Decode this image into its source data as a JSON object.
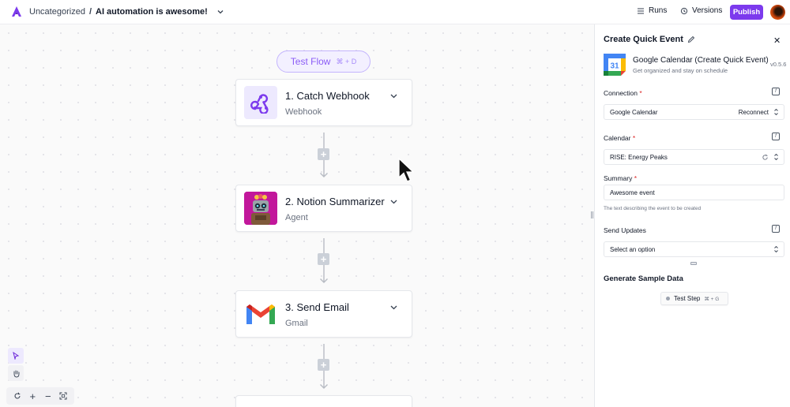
{
  "header": {
    "folder": "Uncategorized",
    "separator": "/",
    "flow_name": "AI automation is awesome!",
    "runs_label": "Runs",
    "versions_label": "Versions",
    "publish_label": "Publish"
  },
  "canvas": {
    "test_flow_label": "Test Flow",
    "test_flow_shortcut": "⌘ + D",
    "steps": [
      {
        "title": "1. Catch Webhook",
        "subtitle": "Webhook",
        "icon": "webhook-icon"
      },
      {
        "title": "2. Notion Summarizer",
        "subtitle": "Agent",
        "icon": "robot-agent-icon"
      },
      {
        "title": "3. Send Email",
        "subtitle": "Gmail",
        "icon": "gmail-icon"
      }
    ],
    "add_button_label": "+"
  },
  "zoom_controls": {
    "plus": "+",
    "minus": "−"
  },
  "panel": {
    "title": "Create Quick Event",
    "piece_name": "Google Calendar (Create Quick Event)",
    "piece_description": "Get organized and stay on schedule",
    "version": "v0.5.6",
    "calendar_icon_day": "31",
    "connection": {
      "label": "Connection",
      "required": "*",
      "value": "Google Calendar",
      "action": "Reconnect"
    },
    "calendar": {
      "label": "Calendar",
      "required": "*",
      "value": "RISE: Energy Peaks"
    },
    "summary": {
      "label": "Summary",
      "required": "*",
      "value": "Awesome event",
      "help": "The text describing the event to be created"
    },
    "send_updates": {
      "label": "Send Updates",
      "placeholder": "Select an option"
    },
    "sample_data": {
      "heading": "Generate Sample Data",
      "test_step_label": "Test Step",
      "test_step_shortcut": "⌘ + G"
    }
  },
  "colors": {
    "accent": "#7c3aed",
    "test_flow_border": "#c4b5fd",
    "required": "#dc2626"
  }
}
